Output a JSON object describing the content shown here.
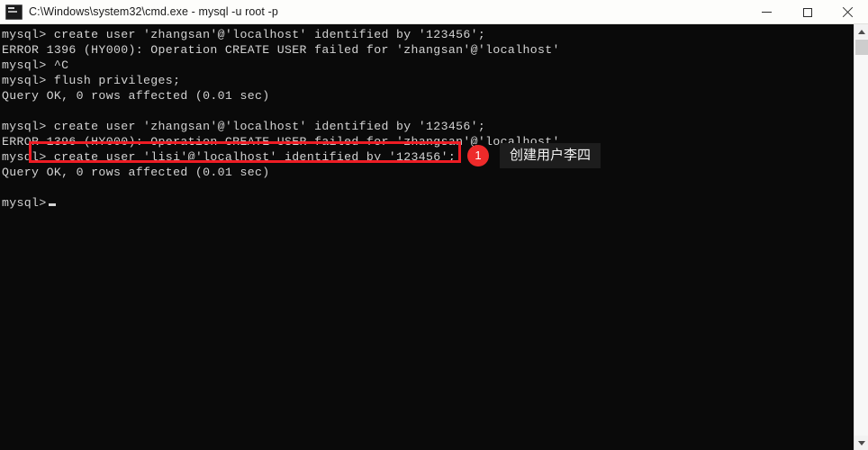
{
  "window": {
    "title": "C:\\Windows\\system32\\cmd.exe - mysql  -u root -p",
    "icon": "cmd-console-icon",
    "controls": {
      "minimize": "—",
      "maximize": "□",
      "close": "✕"
    },
    "colors": {
      "titlebar_bg": "#fdfdfb",
      "console_bg": "#0a0a0a",
      "console_fg": "#d4d4d4",
      "accent_red": "#ee1c24",
      "badge_red": "#ee2a2a",
      "scrollbar_bg": "#f2f2f2"
    }
  },
  "console": {
    "lines": [
      "mysql> create user 'zhangsan'@'localhost' identified by '123456';",
      "ERROR 1396 (HY000): Operation CREATE USER failed for 'zhangsan'@'localhost'",
      "mysql> ^C",
      "mysql> flush privileges;",
      "Query OK, 0 rows affected (0.01 sec)",
      "",
      "mysql> create user 'zhangsan'@'localhost' identified by '123456';",
      "ERROR 1396 (HY000): Operation CREATE USER failed for 'zhangsan'@'localhost'",
      "mysql> create user 'lisi'@'localhost' identified by '123456';",
      "Query OK, 0 rows affected (0.01 sec)",
      "",
      "mysql>"
    ],
    "prompt_cursor": true
  },
  "annotation": {
    "badge_number": "1",
    "label": "创建用户李四",
    "highlighted_command": "mysql> create user 'lisi'@'localhost' identified by '123456';"
  },
  "scrollbar": {
    "up_arrow": "scroll-up-arrow",
    "down_arrow": "scroll-down-arrow",
    "thumb_position": "near-top"
  }
}
